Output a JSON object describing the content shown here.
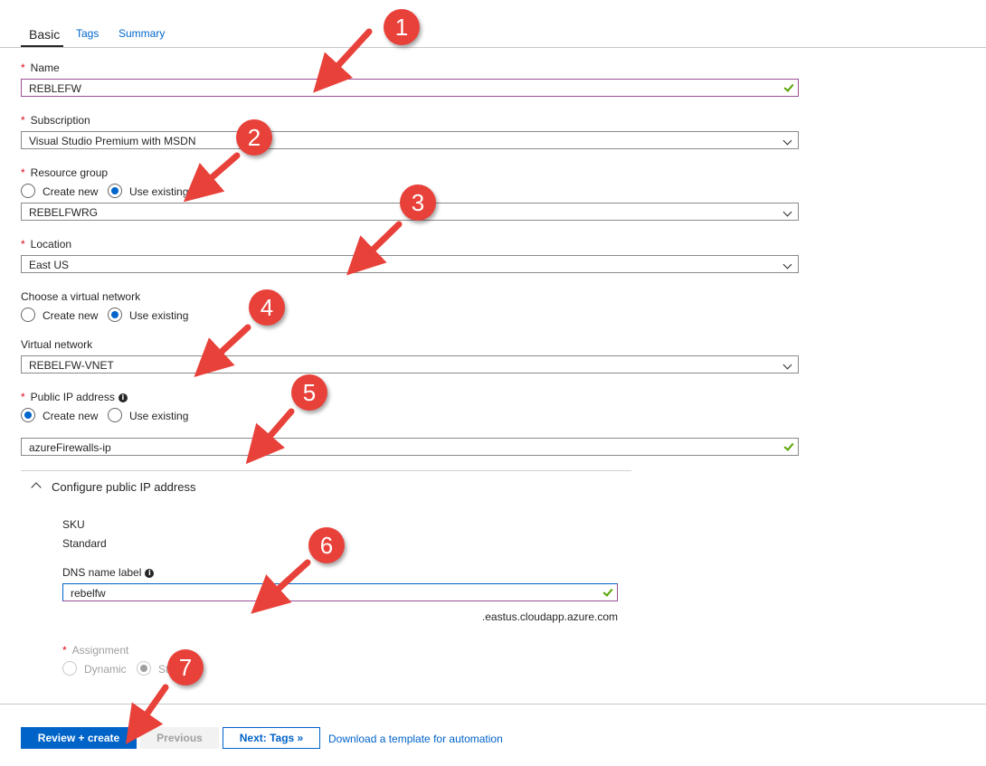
{
  "tabs": [
    {
      "label": "Basic"
    },
    {
      "label": "Tags"
    },
    {
      "label": "Summary"
    }
  ],
  "form": {
    "name": {
      "label": "Name",
      "value": "REBLEFW"
    },
    "subscription": {
      "label": "Subscription",
      "value": "Visual Studio Premium with MSDN"
    },
    "resource_group": {
      "label": "Resource group",
      "option_new": "Create new",
      "option_existing": "Use existing",
      "selected": "Use existing",
      "value": "REBELFWRG"
    },
    "location": {
      "label": "Location",
      "value": "East US"
    },
    "vnet_choice": {
      "label": "Choose a virtual network",
      "option_new": "Create new",
      "option_existing": "Use existing",
      "selected": "Use existing"
    },
    "virtual_network": {
      "label": "Virtual network",
      "value": "REBELFW-VNET"
    },
    "public_ip": {
      "label": "Public IP address",
      "option_new": "Create new",
      "option_existing": "Use existing",
      "selected": "Create new",
      "value": "azureFirewalls-ip"
    },
    "configure_section": {
      "title": "Configure public IP address"
    },
    "sku": {
      "label": "SKU",
      "value": "Standard"
    },
    "dns": {
      "label": "DNS name label",
      "value": "rebelfw",
      "suffix": ".eastus.cloudapp.azure.com"
    },
    "assignment": {
      "label": "Assignment",
      "option_dynamic": "Dynamic",
      "option_static": "St",
      "selected": "Static"
    }
  },
  "footer": {
    "review_create": "Review + create",
    "previous": "Previous",
    "next": "Next: Tags »",
    "download_link": "Download a template for automation"
  },
  "annotations": [
    "1",
    "2",
    "3",
    "4",
    "5",
    "6",
    "7"
  ],
  "colors": {
    "accent": "#0063c8",
    "required": "#e00b1c",
    "valid_check": "#57a300",
    "focus_border": "#9b4f96",
    "marker": "#e8413a"
  }
}
